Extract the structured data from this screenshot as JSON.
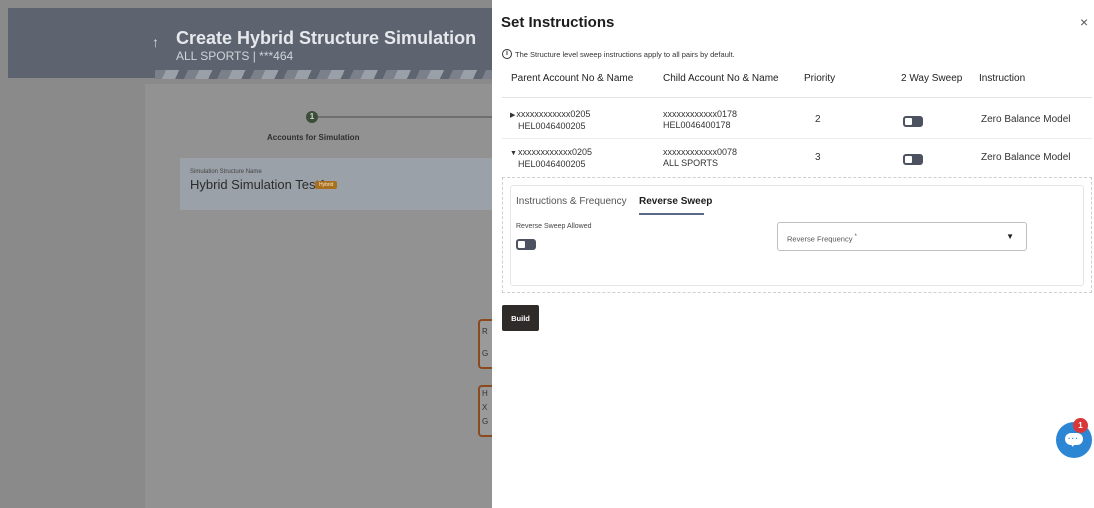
{
  "background": {
    "title": "Create Hybrid Structure Simulation",
    "subtitle": "ALL SPORTS | ***464",
    "step_number": "1",
    "step_label": "Accounts for Simulation",
    "structure_name_label": "Simulation Structure Name",
    "structure_name": "Hybrid Simulation Test1",
    "structure_badge": "Hybrid",
    "node_fragments": [
      [
        "R",
        "G"
      ],
      [
        "H",
        "X",
        "G"
      ]
    ]
  },
  "drawer": {
    "title": "Set Instructions",
    "close": "×",
    "info_icon": "i",
    "info_text": "The Structure level sweep instructions apply to all pairs by default.",
    "columns": [
      "Parent Account No & Name",
      "Child Account No & Name",
      "Priority",
      "2 Way Sweep",
      "Instruction"
    ],
    "rows": [
      {
        "caret": "▶",
        "parent_account": "xxxxxxxxxxxx0205",
        "parent_name": "HEL0046400205",
        "child_account": "xxxxxxxxxxxx0178",
        "child_name": "HEL0046400178",
        "priority": "2",
        "instruction": "Zero Balance Model"
      },
      {
        "caret": "▼",
        "parent_account": "xxxxxxxxxxxx0205",
        "parent_name": "HEL0046400205",
        "child_account": "xxxxxxxxxxxx0078",
        "child_name": "ALL SPORTS",
        "priority": "3",
        "instruction": "Zero Balance Model"
      }
    ],
    "tabs": {
      "instructions_frequency": "Instructions & Frequency",
      "reverse_sweep": "Reverse Sweep"
    },
    "reverse_sweep_allowed_label": "Reverse Sweep Allowed",
    "reverse_frequency_placeholder": "Reverse Frequency",
    "required_marker": "*",
    "build_label": "Build"
  },
  "chat": {
    "badge_count": "1"
  },
  "colors": {
    "toggle": "#4d5260",
    "build_button": "#2f2b29",
    "chat_button": "#2d86d4",
    "badge": "#d9383a",
    "hybrid_badge": "#a8701e"
  }
}
